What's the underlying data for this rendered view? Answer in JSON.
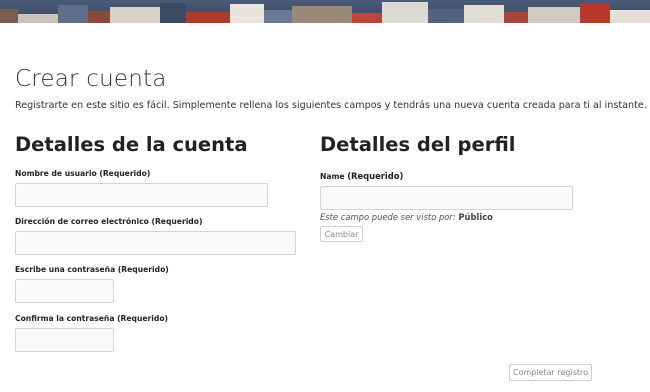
{
  "page": {
    "title": "Crear cuenta",
    "intro": "Registrarte en este sitio es fácil. Simplemente rellena los siguientes campos y tendrás una nueva cuenta creada para ti al instante."
  },
  "account": {
    "heading": "Detalles de la cuenta",
    "username_label": "Nombre de usuario (Requerido)",
    "username_value": "",
    "email_label": "Dirección de correo electrónico (Requerido)",
    "email_value": "",
    "password_label": "Escribe una contraseña (Requerido)",
    "password_value": "",
    "confirm_label": "Confirma la contraseña (Requerido)",
    "confirm_value": ""
  },
  "profile": {
    "heading": "Detalles del perfil",
    "name_label": "Name",
    "name_required": "(Requerido)",
    "name_value": "",
    "visibility_prefix": "Este campo puede ser visto por:",
    "visibility_value": "Público",
    "change_button": "Cambiar"
  },
  "submit_button": "Completar registro",
  "banner": {
    "colors": [
      "#4a5a78",
      "#8a4a3a",
      "#c8c8c0",
      "#6a7a94",
      "#b03a2e",
      "#e8e4dc",
      "#3c4a66"
    ]
  }
}
